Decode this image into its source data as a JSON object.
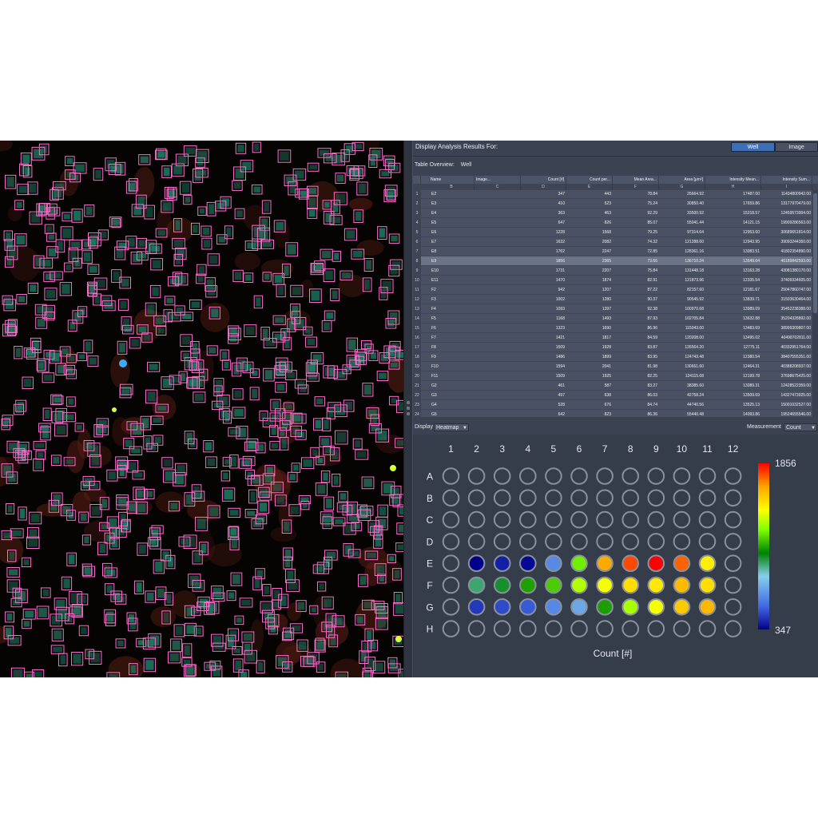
{
  "header": {
    "title": "Display Analysis Results For:",
    "toggle": [
      "Well",
      "Image"
    ],
    "selected": "Well"
  },
  "overview": {
    "label": "Table Overview:",
    "value": "Well"
  },
  "table": {
    "columns": [
      "Name",
      "Image...",
      "Count [#]",
      "Count per...",
      "Mean Area...",
      "Area [µm²]",
      "Intensity Mean...",
      "Intensity Sum..."
    ],
    "letters": [
      "B",
      "C",
      "D",
      "E",
      "F",
      "G",
      "H",
      "I"
    ],
    "selected_row": 8,
    "rows": [
      [
        "E2",
        "",
        "347",
        "443",
        "78.84",
        "26664.92",
        "17487.00",
        "11434800942.00"
      ],
      [
        "E3",
        "",
        "410",
        "523",
        "75.24",
        "30850.40",
        "17659.86",
        "13177970479.00"
      ],
      [
        "E4",
        "",
        "363",
        "463",
        "92.29",
        "33500.92",
        "15218.57",
        "12459573004.00"
      ],
      [
        "E5",
        "",
        "647",
        "826",
        "85.07",
        "55041.44",
        "14121.15",
        "19909286563.00"
      ],
      [
        "E6",
        "",
        "1228",
        "1568",
        "79.25",
        "97314.64",
        "12953.60",
        "30689651814.00"
      ],
      [
        "E7",
        "",
        "1632",
        "2082",
        "74.32",
        "121288.60",
        "12943.95",
        "39093244350.00"
      ],
      [
        "E8",
        "",
        "1762",
        "2247",
        "72.85",
        "128361.16",
        "13083.51",
        "41802354890.00"
      ],
      [
        "E9",
        "",
        "1856",
        "2365",
        "73.66",
        "136710.24",
        "13549.64",
        "46189842593.00"
      ],
      [
        "E10",
        "",
        "1731",
        "2207",
        "75.84",
        "131448.18",
        "13163.28",
        "43081380170.00"
      ],
      [
        "E11",
        "",
        "1470",
        "1874",
        "82.91",
        "121873.96",
        "12335.54",
        "37409334605.00"
      ],
      [
        "F2",
        "",
        "942",
        "1207",
        "87.22",
        "82157.60",
        "12181.67",
        "25047860747.00"
      ],
      [
        "F3",
        "",
        "1002",
        "1280",
        "90.37",
        "90545.92",
        "13839.71",
        "31503630464.00"
      ],
      [
        "F4",
        "",
        "1093",
        "1397",
        "92.38",
        "100970.68",
        "13989.09",
        "35452238388.00"
      ],
      [
        "F5",
        "",
        "1168",
        "1493",
        "87.93",
        "102705.84",
        "13632.88",
        "35204328892.00"
      ],
      [
        "F6",
        "",
        "1323",
        "1690",
        "86.96",
        "115043.00",
        "13483.69",
        "38999309807.00"
      ],
      [
        "F7",
        "",
        "1421",
        "1817",
        "84.59",
        "120208.00",
        "13495.02",
        "40498702811.00"
      ],
      [
        "F8",
        "",
        "1509",
        "1928",
        "83.87",
        "126564.20",
        "12775.11",
        "40332951764.00"
      ],
      [
        "F9",
        "",
        "1486",
        "1899",
        "83.95",
        "124743.48",
        "12380.54",
        "38407555351.00"
      ],
      [
        "F10",
        "",
        "1594",
        "2041",
        "81.98",
        "130661.60",
        "12464.31",
        "40388208937.00"
      ],
      [
        "F11",
        "",
        "1509",
        "1925",
        "82.25",
        "124115.68",
        "12199.78",
        "37698675425.00"
      ],
      [
        "G2",
        "",
        "461",
        "587",
        "83.27",
        "38385.60",
        "13089.31",
        "12428522359.00"
      ],
      [
        "G3",
        "",
        "497",
        "638",
        "86.03",
        "42758.24",
        "13509.69",
        "14327473925.00"
      ],
      [
        "G4",
        "",
        "528",
        "676",
        "84.74",
        "44740.56",
        "13525.13",
        "15001032527.00"
      ],
      [
        "G5",
        "",
        "642",
        "823",
        "86.36",
        "55440.48",
        "14093.86",
        "19524655546.00"
      ],
      [
        "G6",
        "",
        "726",
        "964",
        "84.44",
        "65577.30",
        "13878.90",
        "22701653172.00"
      ]
    ]
  },
  "display": {
    "label": "Display",
    "mode": "Heatmap",
    "measurement_label": "Measurement",
    "measurement": "Count"
  },
  "heatmap": {
    "columns": [
      "1",
      "2",
      "3",
      "4",
      "5",
      "6",
      "7",
      "8",
      "9",
      "10",
      "11",
      "12"
    ],
    "rows": [
      "A",
      "B",
      "C",
      "D",
      "E",
      "F",
      "G",
      "H"
    ],
    "title": "Count [#]",
    "scale_max": "1856",
    "scale_min": "347",
    "min_value": 347,
    "max_value": 1856,
    "colors": [
      "#00008b",
      "#4169e1",
      "#87ceeb",
      "#008000",
      "#7fff00",
      "#ffff00",
      "#ffa500",
      "#ff0000"
    ],
    "wells": {
      "E": [
        null,
        347,
        410,
        363,
        647,
        1228,
        1632,
        1762,
        1856,
        1731,
        1470,
        null
      ],
      "F": [
        null,
        942,
        1002,
        1093,
        1168,
        1323,
        1421,
        1509,
        1486,
        1594,
        1509,
        null
      ],
      "G": [
        null,
        461,
        497,
        528,
        642,
        726,
        1090,
        1310,
        1420,
        1560,
        1600,
        null
      ]
    }
  },
  "image": {
    "description_colors": [
      "#ff66cc",
      "#1f8f6f",
      "#7a2a1f"
    ]
  }
}
